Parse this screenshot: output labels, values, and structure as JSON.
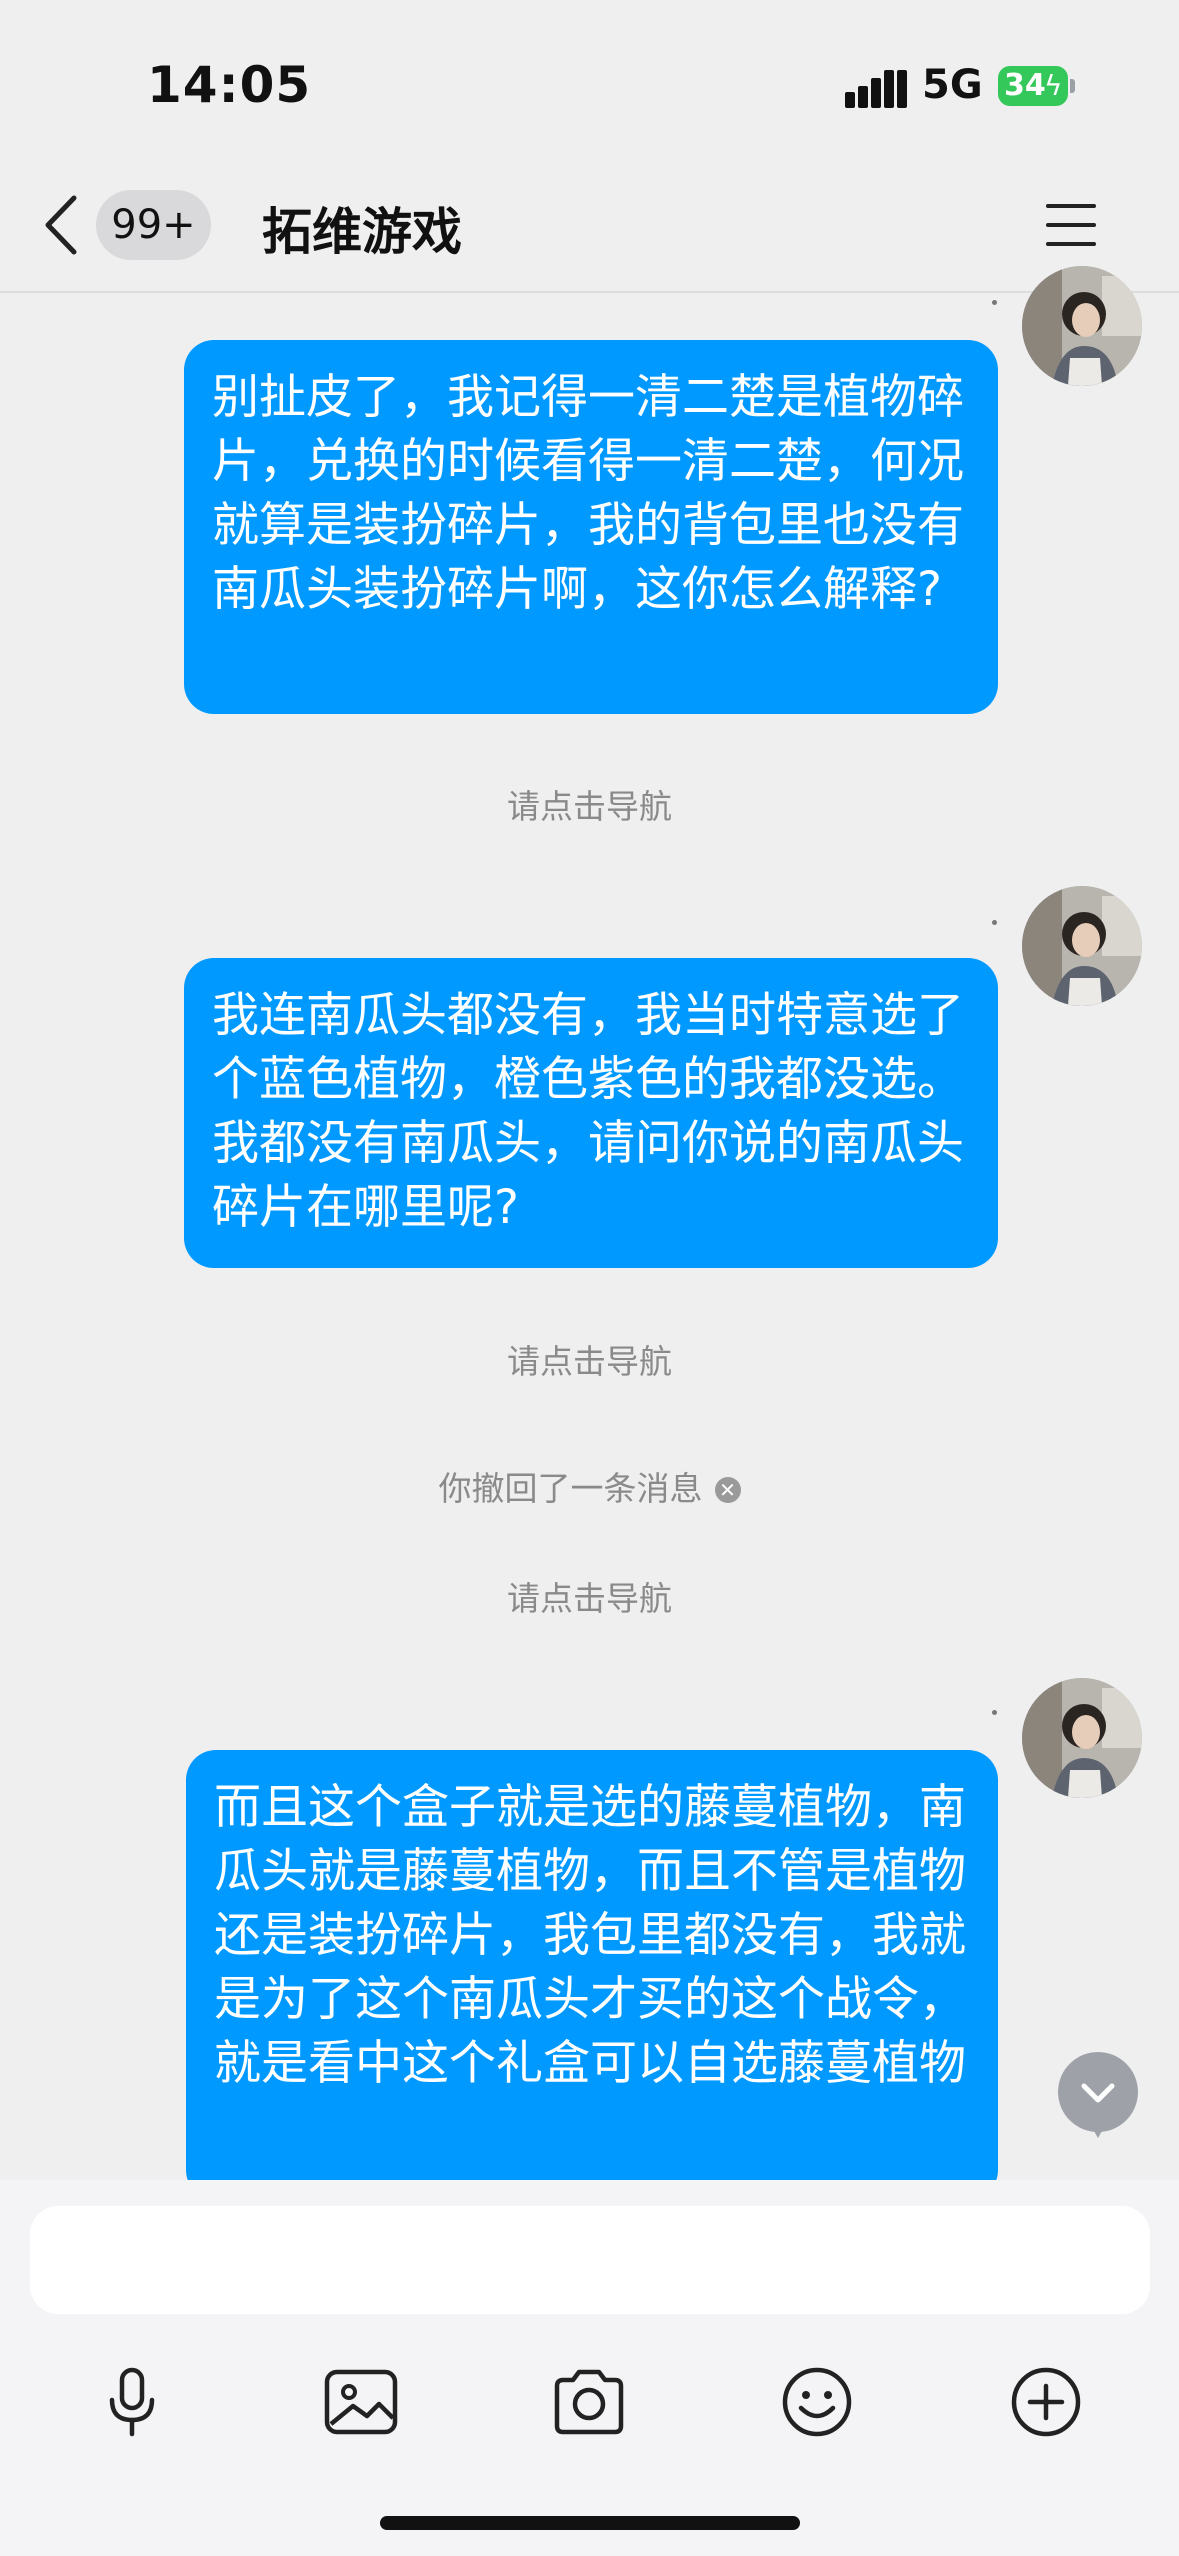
{
  "status_bar": {
    "time": "14:05",
    "network": "5G",
    "battery": "34"
  },
  "header": {
    "unread_count": "99+",
    "title": "拓维游戏"
  },
  "messages": [
    {
      "text": "别扯皮了，我记得一清二楚是植物碎片，兑换的时候看得一清二楚，何况就算是装扮碎片，我的背包里也没有南瓜头装扮碎片啊，这你怎么解释?"
    },
    {
      "text": "我连南瓜头都没有，我当时特意选了个蓝色植物，橙色紫色的我都没选。我都没有南瓜头，请问你说的南瓜头碎片在哪里呢?"
    },
    {
      "text": "而且这个盒子就是选的藤蔓植物，南瓜头就是藤蔓植物，而且不管是植物还是装扮碎片，我包里都没有，我就是为了这个南瓜头才买的这个战令，就是看中这个礼盒可以自选藤蔓植物"
    }
  ],
  "system_notices": {
    "navigate": "请点击导航",
    "recalled": "你撤回了一条消息"
  },
  "input": {
    "placeholder": ""
  },
  "colors": {
    "bubble": "#0099ff",
    "background": "#efeff0"
  }
}
